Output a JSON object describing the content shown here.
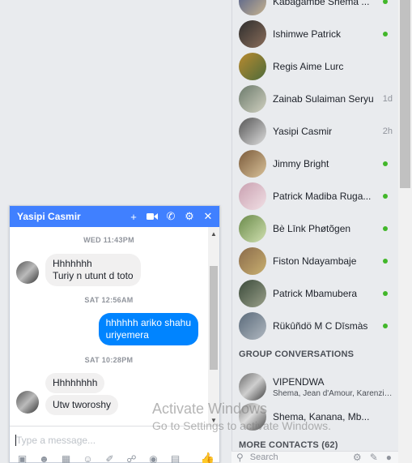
{
  "contacts": [
    {
      "name": "Kabagambe Shema ...",
      "status": "online",
      "time": ""
    },
    {
      "name": "Ishimwe Patrick",
      "status": "online",
      "time": ""
    },
    {
      "name": "Regis Aime Lurc",
      "status": "",
      "time": ""
    },
    {
      "name": "Zainab Sulaiman Seryu",
      "status": "",
      "time": "1d"
    },
    {
      "name": "Yasipi Casmir",
      "status": "",
      "time": "2h"
    },
    {
      "name": "Jimmy Bright",
      "status": "online",
      "time": ""
    },
    {
      "name": "Patrick Madiba Ruga...",
      "status": "online",
      "time": ""
    },
    {
      "name": "Bè Līnk Phøtõgen",
      "status": "online",
      "time": ""
    },
    {
      "name": "Fiston Ndayambaje",
      "status": "online",
      "time": ""
    },
    {
      "name": "Patrick Mbamubera",
      "status": "online",
      "time": ""
    },
    {
      "name": "Rükûñdö M C Dīsmàs",
      "status": "online",
      "time": ""
    }
  ],
  "group_section": {
    "title": "GROUP CONVERSATIONS"
  },
  "groups": [
    {
      "name": "VIPENDWA",
      "members": "Shema, Jean d'Amour, Karenzi, ..."
    },
    {
      "name": "Shema, Kanana, Mb...",
      "members": ""
    }
  ],
  "more_contacts": {
    "title": "MORE CONTACTS (62)"
  },
  "search": {
    "placeholder": "Search"
  },
  "chat": {
    "title": "Yasipi Casmir",
    "day1": "WED 11:43PM",
    "msg1_line1": "Hhhhhhh",
    "msg1_line2": "Turiy n utunt d toto",
    "day2": "SAT 12:56AM",
    "msg2_line1": "hhhhhh ariko shahu",
    "msg2_line2": "uriyemera",
    "day3": "SAT 10:28PM",
    "msg3": "Hhhhhhhh",
    "msg4": "Utw tworoshy",
    "composer_placeholder": "Type a message..."
  },
  "watermark": {
    "line1": "Activate Windows",
    "line2": "Go to Settings to activate Windows."
  },
  "colors": {
    "accent": "#4080ff",
    "online": "#42b72a",
    "bubble_out": "#0084ff"
  }
}
